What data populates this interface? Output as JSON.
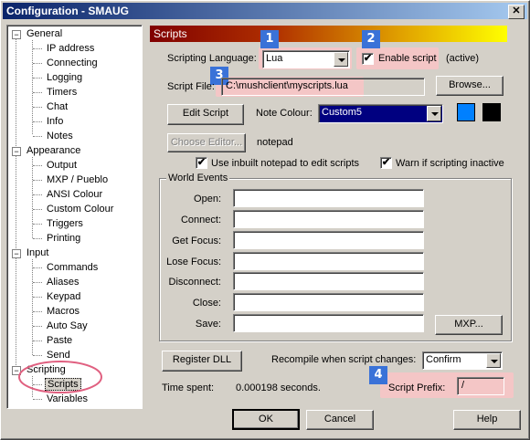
{
  "window": {
    "title": "Configuration - SMAUG",
    "close_glyph": "✕"
  },
  "tree": {
    "groups": [
      {
        "label": "General",
        "expander": "−",
        "children": [
          "IP address",
          "Connecting",
          "Logging",
          "Timers",
          "Chat",
          "Info",
          "Notes"
        ]
      },
      {
        "label": "Appearance",
        "expander": "−",
        "children": [
          "Output",
          "MXP / Pueblo",
          "ANSI Colour",
          "Custom Colour",
          "Triggers",
          "Printing"
        ]
      },
      {
        "label": "Input",
        "expander": "−",
        "children": [
          "Commands",
          "Aliases",
          "Keypad",
          "Macros",
          "Auto Say",
          "Paste",
          "Send"
        ]
      },
      {
        "label": "Scripting",
        "expander": "−",
        "children": [
          "Scripts",
          "Variables"
        ]
      }
    ],
    "selected": "Scripts"
  },
  "header": {
    "title": "Scripts"
  },
  "badges": [
    "1",
    "2",
    "3",
    "4"
  ],
  "colors": {
    "highlight": "#f4c6c6",
    "badge": "#3a72d8",
    "note_colour_1": "#0080ff",
    "note_colour_2": "#000000",
    "circle": "#e06080"
  },
  "language": {
    "label": "Scripting Language:",
    "value": "Lua"
  },
  "enable": {
    "label": "Enable script",
    "checked": "✔",
    "status": "(active)"
  },
  "script_file": {
    "label": "Script File:",
    "value": "C:\\mushclient\\myscripts.lua",
    "browse": "Browse..."
  },
  "edit_script": "Edit Script",
  "note_colour": {
    "label": "Note Colour:",
    "value": "Custom5"
  },
  "choose_editor": {
    "label": "Choose Editor...",
    "editor": "notepad"
  },
  "options": {
    "inbuilt": {
      "label": "Use inbuilt notepad to edit scripts",
      "checked": "✔"
    },
    "warn": {
      "label": "Warn if scripting inactive",
      "checked": "✔"
    }
  },
  "world_events": {
    "title": "World Events",
    "fields": [
      "Open:",
      "Connect:",
      "Get Focus:",
      "Lose Focus:",
      "Disconnect:",
      "Close:",
      "Save:"
    ],
    "mxp": "MXP..."
  },
  "register_dll": "Register DLL",
  "recompile": {
    "label": "Recompile when script changes:",
    "value": "Confirm"
  },
  "time_spent": {
    "label": "Time spent:",
    "value": "0.000198 seconds."
  },
  "prefix": {
    "label": "Script Prefix:",
    "value": "/"
  },
  "buttons": {
    "ok": "OK",
    "cancel": "Cancel",
    "help": "Help"
  }
}
